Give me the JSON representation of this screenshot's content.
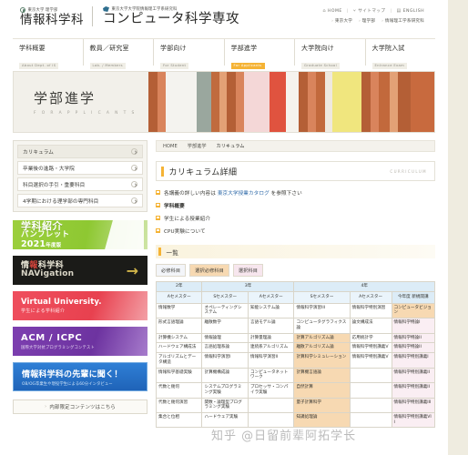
{
  "header": {
    "brand1_sup": "東京大学 理学部",
    "brand1_main": "情報科学科",
    "brand2_sup": "東京大学大学院情報理工学系研究科",
    "brand2_main": "コンピュータ科学専攻",
    "utils": [
      {
        "icon": "home-icon",
        "glyph": "⌂",
        "label": "HOME"
      },
      {
        "icon": "sitemap-icon",
        "glyph": "⑂",
        "label": "サイトマップ"
      },
      {
        "icon": "english-icon",
        "glyph": "▤",
        "label": "ENGLISH"
      }
    ],
    "crumbs": [
      "東京大学",
      "理学部",
      "情報理工学系研究科"
    ]
  },
  "nav": [
    {
      "jp": "学科概要",
      "en": "About Dept. of IS",
      "active": false
    },
    {
      "jp": "教員／研究室",
      "en": "Lab. / Members",
      "active": false
    },
    {
      "jp": "学部向け",
      "en": "For Student",
      "active": false
    },
    {
      "jp": "学部進学",
      "en": "For Applicants",
      "active": true
    },
    {
      "jp": "大学院向け",
      "en": "Graduate School",
      "active": false
    },
    {
      "jp": "大学院入試",
      "en": "Entrance Exam",
      "active": false
    }
  ],
  "hero": {
    "jp": "学部進学",
    "en": "F O R   A P P L I C A N T S"
  },
  "sidebar": {
    "menu": [
      {
        "label": "カリキュラム",
        "current": true
      },
      {
        "label": "卒業後の進路・大学院",
        "current": false
      },
      {
        "label": "科目選択の手引・重要科目",
        "current": false
      },
      {
        "label": "4学期における理学部の専門科目",
        "current": false
      }
    ],
    "banners": [
      {
        "name": "pamphlet-banner",
        "l1": "学科紹介",
        "l2": "パンフレット",
        "l3": "2021",
        "l3sub": "年度版"
      },
      {
        "name": "navigation-banner",
        "l1a": "情",
        "l1b": "報",
        "l1c": "科学科",
        "l2": "NAVigation"
      },
      {
        "name": "virtual-university-banner",
        "l1": "Virtual University.",
        "l2": "学生による学科紹介"
      },
      {
        "name": "acm-icpc-banner",
        "l1": "ACM / ICPC",
        "l2": "国際大学対抗プログラミングコンテスト"
      },
      {
        "name": "senior-interview-banner",
        "l1": "情報科学科の先輩に聞く！",
        "l2": "OB/OG卒業生や現役学生による60分インタビュー"
      }
    ],
    "internal_button": "内部限定コンテンツはこちら"
  },
  "main": {
    "breadcrumb": [
      "HOME",
      "学部進学",
      "カリキュラム"
    ],
    "page_title": "カリキュラム詳細",
    "page_title_en": "CURRICULUM",
    "notes": [
      {
        "pre": "各講義の詳しい内容は ",
        "link": "東京大学授業カタログ",
        "post": " を参照下さい",
        "bold": false
      },
      {
        "pre": "",
        "link": "",
        "post": "学科概要",
        "bold": true
      },
      {
        "pre": "",
        "link": "",
        "post": "学生による授業紹介",
        "bold": false
      },
      {
        "pre": "",
        "link": "",
        "post": "CPU実験について",
        "bold": false
      }
    ],
    "section_title": "一覧",
    "legend": [
      {
        "label": "必修科目",
        "kind": "k0"
      },
      {
        "label": "選択必修科目",
        "kind": "k1"
      },
      {
        "label": "選択科目",
        "kind": "k2"
      }
    ]
  },
  "table": {
    "years": [
      {
        "label": "2年",
        "span": 1
      },
      {
        "label": "3年",
        "span": 2
      },
      {
        "label": "4年",
        "span": 3
      }
    ],
    "semesters": [
      "Aセメスター",
      "Sセメスター",
      "Aセメスター",
      "Sセメスター",
      "Aセメスター"
    ],
    "newly_col": "今年度\n新規開講",
    "rows": [
      [
        {
          "t": "情報数学",
          "k": "k0"
        },
        {
          "t": "オペレーティングシステム",
          "k": "k0"
        },
        {
          "t": "知能システム論",
          "k": "k0"
        },
        {
          "t": "情報科学演習III",
          "k": "k0"
        },
        {
          "t": "情報科学特別演習",
          "k": "k0"
        },
        {
          "t": "コンピュータビジョン",
          "k": "k1"
        }
      ],
      [
        {
          "t": "形式言語理論",
          "k": "k0"
        },
        {
          "t": "離散数学",
          "k": "k0"
        },
        {
          "t": "言語モデル論",
          "k": "k0"
        },
        {
          "t": "コンピュータグラフィクス論",
          "k": "k0"
        },
        {
          "t": "論文構成法",
          "k": "k0"
        },
        {
          "t": "情報科学特論I",
          "k": "k2"
        }
      ],
      [
        {
          "t": "計算機システム",
          "k": "k0"
        },
        {
          "t": "情報論理",
          "k": "k0"
        },
        {
          "t": "計算量理論",
          "k": "k0"
        },
        {
          "t": "計算アルゴリズム論",
          "k": "k1"
        },
        {
          "t": "応用統計学",
          "k": "k0"
        },
        {
          "t": "情報科学特論II",
          "k": "k2"
        }
      ],
      [
        {
          "t": "ハードウェア構成法",
          "k": "k0"
        },
        {
          "t": "言語処理系論",
          "k": "k0"
        },
        {
          "t": "連続系アルゴリズム",
          "k": "k0"
        },
        {
          "t": "離散アルゴリズム論",
          "k": "k1"
        },
        {
          "t": "情報科学特別講義V",
          "k": "k0"
        },
        {
          "t": "情報科学特論II",
          "k": "k2"
        }
      ],
      [
        {
          "t": "アルゴリズムとデータ構造",
          "k": "k0"
        },
        {
          "t": "情報科学演習I",
          "k": "k0"
        },
        {
          "t": "情報科学演習II",
          "k": "k0"
        },
        {
          "t": "計算科学シミュレーション",
          "k": "k1"
        },
        {
          "t": "情報科学特別講義V",
          "k": "k0"
        },
        {
          "t": "情報科学特別講義I",
          "k": "k2"
        }
      ],
      [
        {
          "t": "情報科学基礎実験",
          "k": "k0"
        },
        {
          "t": "計算機構成論",
          "k": "k0"
        },
        {
          "t": "コンピュータネットワーク",
          "k": "k0"
        },
        {
          "t": "計算機言語論",
          "k": "k1"
        },
        {
          "t": "",
          "k": "blank"
        },
        {
          "t": "情報科学特別講義II",
          "k": "k2"
        }
      ],
      [
        {
          "t": "代数と幾何",
          "k": "k0"
        },
        {
          "t": "システムプログラミング実験",
          "k": "k0"
        },
        {
          "t": "プロセッサ・コンパイラ実験",
          "k": "k0"
        },
        {
          "t": "自然計算",
          "k": "k1"
        },
        {
          "t": "",
          "k": "blank"
        },
        {
          "t": "情報科学特別講義II",
          "k": "k2"
        }
      ],
      [
        {
          "t": "代数と幾何演習",
          "k": "k0"
        },
        {
          "t": "関数・論理型プログラミング実験",
          "k": "k0"
        },
        {
          "t": "",
          "k": "blank"
        },
        {
          "t": "量子計算科学",
          "k": "k1"
        },
        {
          "t": "",
          "k": "blank"
        },
        {
          "t": "情報科学特別講義III",
          "k": "k2"
        }
      ],
      [
        {
          "t": "集合と位相",
          "k": "k0"
        },
        {
          "t": "ハードウェア実験",
          "k": "k0"
        },
        {
          "t": "",
          "k": "blank"
        },
        {
          "t": "知識処理論",
          "k": "k1"
        },
        {
          "t": "",
          "k": "blank"
        },
        {
          "t": "情報科学特別講義VII",
          "k": "k2"
        }
      ]
    ]
  },
  "watermark": "知乎 @日留前辈阿拓学长",
  "colors": {
    "accent": "#f5b335",
    "page_bg": "#efece0",
    "required": "#ffffff",
    "elective_required": "#f7d9b2",
    "elective": "#faeef3",
    "year_header": "#dcecf7",
    "sem_header": "#eaf4fb"
  }
}
